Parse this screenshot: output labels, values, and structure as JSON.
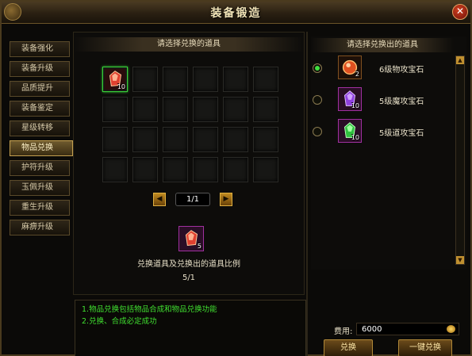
{
  "window": {
    "title": "装备锻造"
  },
  "sidebar": {
    "items": [
      {
        "label": "装备强化",
        "active": false
      },
      {
        "label": "装备升级",
        "active": false
      },
      {
        "label": "品质提升",
        "active": false
      },
      {
        "label": "装备鉴定",
        "active": false
      },
      {
        "label": "星级转移",
        "active": false
      },
      {
        "label": "物品兑换",
        "active": true
      },
      {
        "label": "护符升级",
        "active": false
      },
      {
        "label": "玉佩升级",
        "active": false
      },
      {
        "label": "重生升级",
        "active": false
      },
      {
        "label": "麻痹升级",
        "active": false
      }
    ]
  },
  "input_panel": {
    "header": "请选择兑换的道具",
    "selected_item": {
      "icon": "red-gem-icon",
      "count": "10"
    },
    "pagination": {
      "text": "1/1"
    },
    "ratio": {
      "label": "兑换道具及兑换出的道具比例",
      "value": "5/1",
      "item_count": "5",
      "icon": "red-gem-icon"
    }
  },
  "output_panel": {
    "header": "请选择兑换出的道具",
    "items": [
      {
        "name": "6级物攻宝石",
        "count": "2",
        "icon": "orange-gem-icon",
        "selected": true
      },
      {
        "name": "5级魔攻宝石",
        "count": "10",
        "icon": "purple-gem-icon",
        "selected": false
      },
      {
        "name": "5级道攻宝石",
        "count": "10",
        "icon": "green-gem-icon",
        "selected": false
      }
    ]
  },
  "info": {
    "lines": [
      "1.物品兑换包括物品合成和物品兑换功能",
      "2.兑换、合成必定成功"
    ]
  },
  "fee": {
    "label": "费用:",
    "value": "6000"
  },
  "buttons": {
    "exchange": "兑换",
    "exchange_all": "一键兑换"
  },
  "colors": {
    "accent": "#c4a050",
    "info_text": "#40e030",
    "selected_border": "#38d038"
  }
}
